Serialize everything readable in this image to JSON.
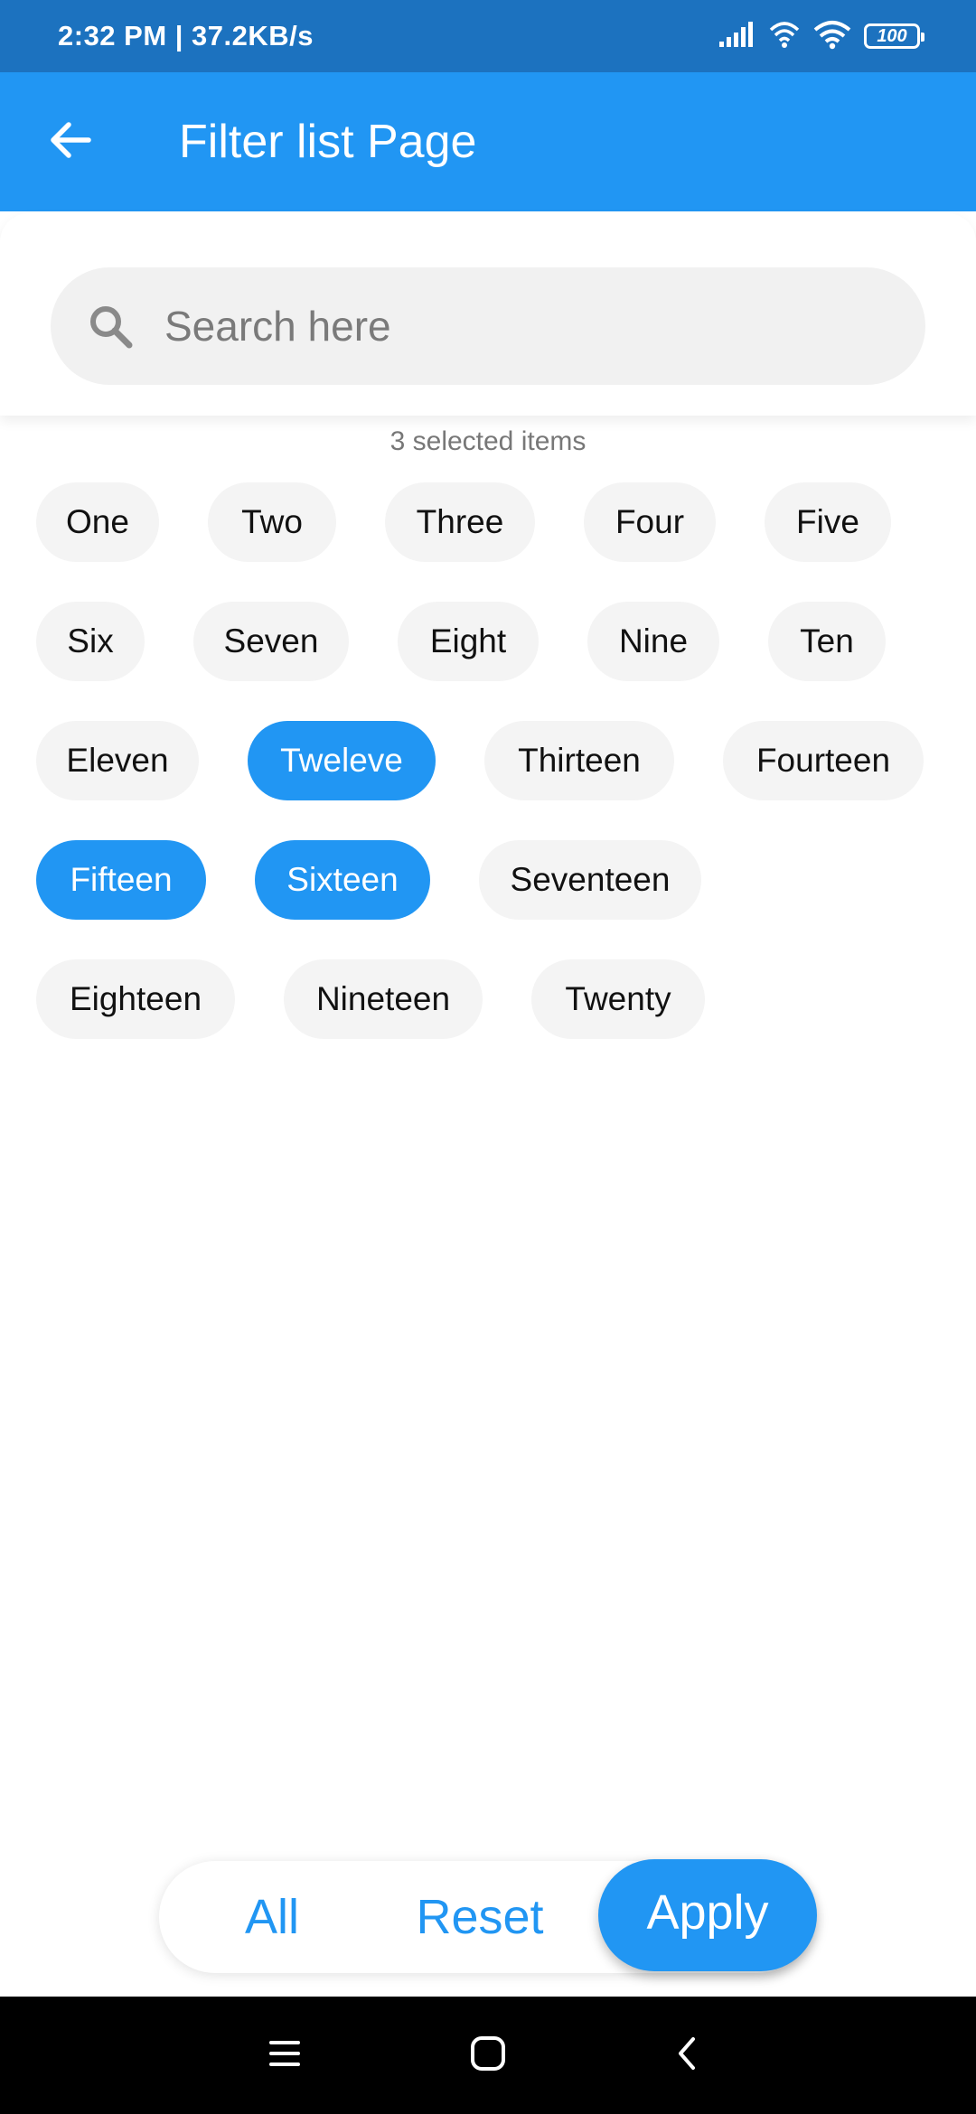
{
  "status_bar": {
    "time_speed": "2:32 PM | 37.2KB/s",
    "battery": "100"
  },
  "app_bar": {
    "title": "Filter list Page"
  },
  "search": {
    "placeholder": "Search here",
    "value": ""
  },
  "selection_summary": "3 selected items",
  "chips": [
    {
      "label": "One",
      "selected": false
    },
    {
      "label": "Two",
      "selected": false
    },
    {
      "label": "Three",
      "selected": false
    },
    {
      "label": "Four",
      "selected": false
    },
    {
      "label": "Five",
      "selected": false
    },
    {
      "label": "Six",
      "selected": false
    },
    {
      "label": "Seven",
      "selected": false
    },
    {
      "label": "Eight",
      "selected": false
    },
    {
      "label": "Nine",
      "selected": false
    },
    {
      "label": "Ten",
      "selected": false
    },
    {
      "label": "Eleven",
      "selected": false
    },
    {
      "label": "Tweleve",
      "selected": true
    },
    {
      "label": "Thirteen",
      "selected": false
    },
    {
      "label": "Fourteen",
      "selected": false
    },
    {
      "label": "Fifteen",
      "selected": true
    },
    {
      "label": "Sixteen",
      "selected": true
    },
    {
      "label": "Seventeen",
      "selected": false
    },
    {
      "label": "Eighteen",
      "selected": false
    },
    {
      "label": "Nineteen",
      "selected": false
    },
    {
      "label": "Twenty",
      "selected": false
    }
  ],
  "actions": {
    "all_label": "All",
    "reset_label": "Reset",
    "apply_label": "Apply"
  },
  "colors": {
    "primary": "#2196f3",
    "status_bar": "#1c72bf",
    "chip_bg": "#f4f4f4"
  }
}
